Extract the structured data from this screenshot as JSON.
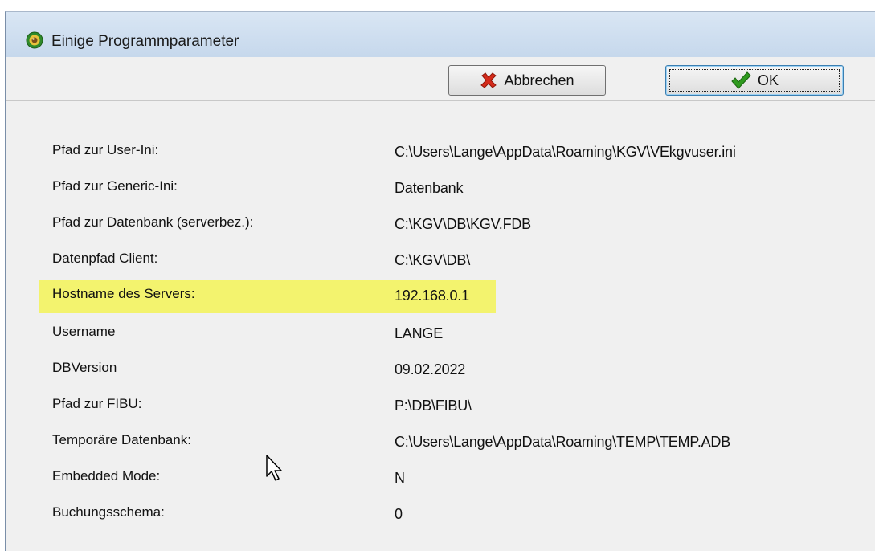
{
  "window": {
    "title": "Einige Programmparameter",
    "icon": "kgv-app-icon"
  },
  "toolbar": {
    "cancel_label": "Abbrechen",
    "cancel_icon": "red-x-icon",
    "ok_label": "OK",
    "ok_icon": "green-check-icon"
  },
  "params": [
    {
      "label": "Pfad zur User-Ini:",
      "value": "C:\\Users\\Lange\\AppData\\Roaming\\KGV\\VEkgvuser.ini"
    },
    {
      "label": "Pfad zur Generic-Ini:",
      "value": "Datenbank"
    },
    {
      "label": "Pfad zur Datenbank (serverbez.):",
      "value": "C:\\KGV\\DB\\KGV.FDB"
    },
    {
      "label": "Datenpfad Client:",
      "value": "C:\\KGV\\DB\\"
    },
    {
      "label": "Hostname des Servers:",
      "value": "192.168.0.1"
    },
    {
      "label": "Username",
      "value": "LANGE"
    },
    {
      "label": "DBVersion",
      "value": "09.02.2022"
    },
    {
      "label": "Pfad zur FIBU:",
      "value": "P:\\DB\\FIBU\\"
    },
    {
      "label": "Temporäre Datenbank:",
      "value": "C:\\Users\\Lange\\AppData\\Roaming\\TEMP\\TEMP.ADB"
    },
    {
      "label": "Embedded Mode:",
      "value": "N"
    },
    {
      "label": "Buchungsschema:",
      "value": "0"
    }
  ],
  "colors": {
    "highlight": "#f3f36e",
    "titlebar": "#c6d8ec",
    "cancel_icon": "#d42a1a",
    "ok_icon": "#2e9a1e"
  }
}
